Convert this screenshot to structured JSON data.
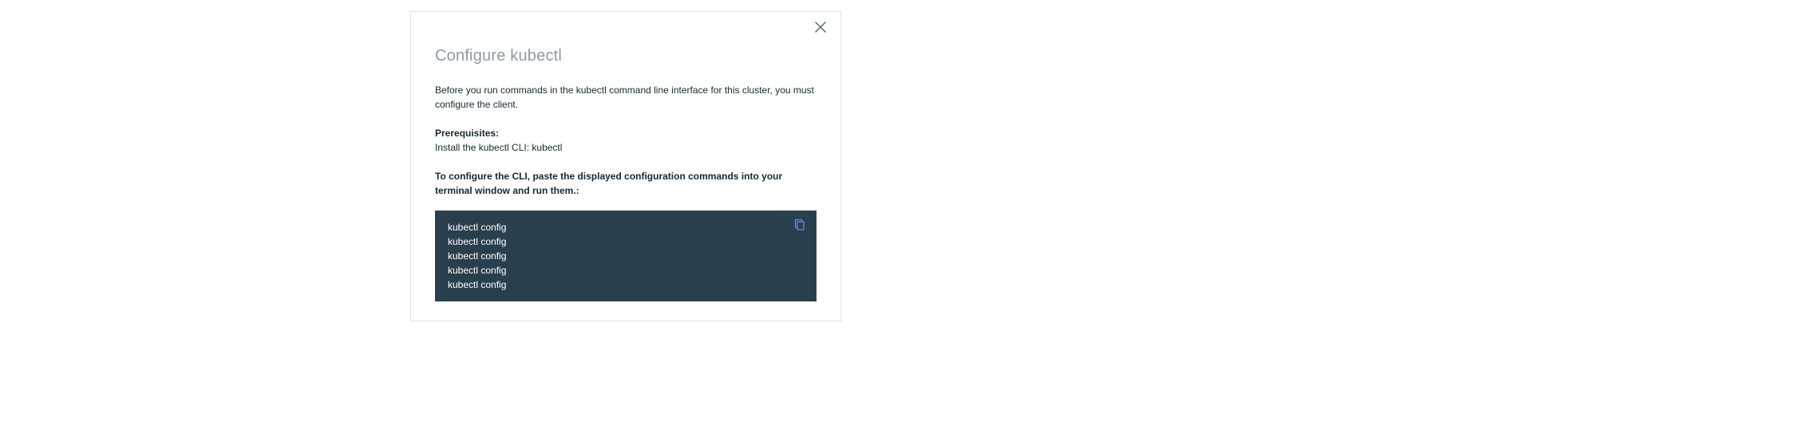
{
  "modal": {
    "title": "Configure kubectl",
    "intro": "Before you run commands in the kubectl command line interface for this cluster, you must configure the client.",
    "prerequisites_label": "Prerequisites:",
    "prerequisites_text": "Install the kubectl CLI: kubectl",
    "instructions": "To configure the CLI, paste the displayed configuration commands into your terminal window and run them.:",
    "commands": [
      "kubectl config",
      "kubectl config",
      "kubectl config",
      "kubectl config",
      "kubectl config"
    ]
  },
  "icons": {
    "close": "close-icon",
    "copy": "copy-icon"
  },
  "colors": {
    "border": "#dfe3e6",
    "title_text": "#8c9ba5",
    "body_text": "#152934",
    "code_bg": "#2a3f4d",
    "code_text": "#ffffff",
    "copy_icon": "#5596e6",
    "close_icon": "#5a6872"
  }
}
